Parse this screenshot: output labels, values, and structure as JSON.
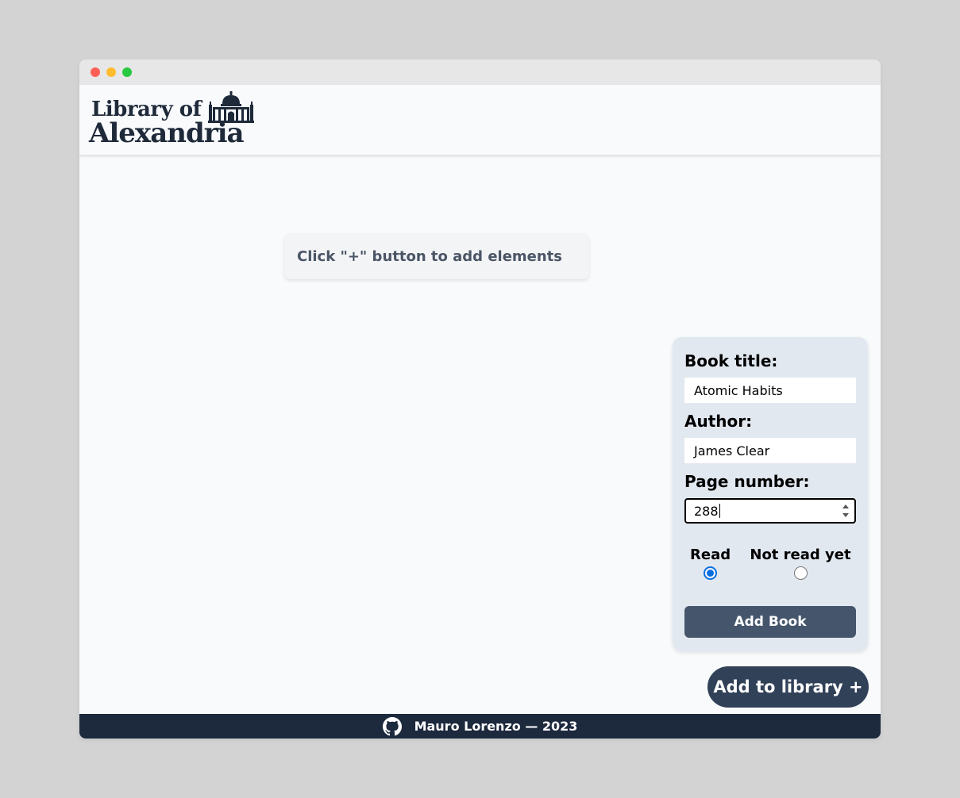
{
  "header": {
    "logo_line1": "Library of",
    "logo_line2": "Alexandria"
  },
  "main": {
    "empty_message": "Click \"+\" button to add elements"
  },
  "form": {
    "title_label": "Book title:",
    "title_value": "Atomic Habits",
    "author_label": "Author:",
    "author_value": "James Clear",
    "pages_label": "Page number:",
    "pages_value": "288",
    "read_label": "Read",
    "read_selected": true,
    "not_read_label": "Not read yet",
    "submit_label": "Add Book"
  },
  "fab": {
    "label": "Add to library +"
  },
  "footer": {
    "icon": "github-icon",
    "text": "Mauro Lorenzo — 2023"
  },
  "colors": {
    "header_text": "#1e2939",
    "form_bg": "#e2e8f0",
    "button_bg": "#45556c",
    "fab_bg": "#314158",
    "footer_bg": "#1d293d",
    "radio_accent": "#0b6ee0"
  }
}
